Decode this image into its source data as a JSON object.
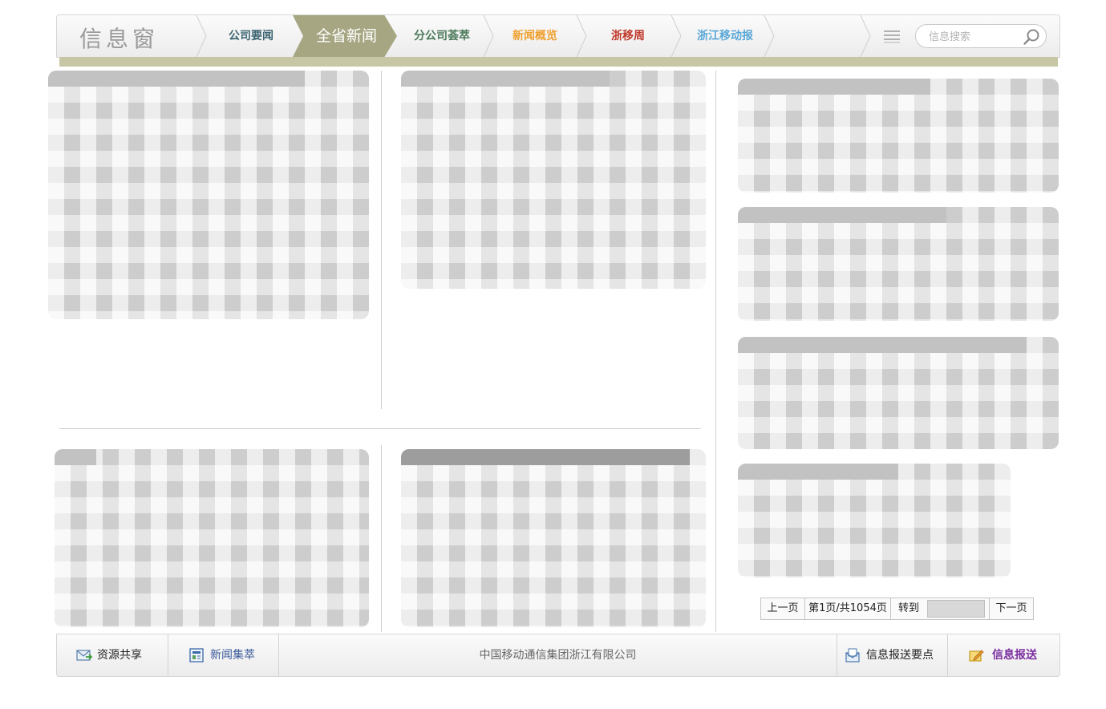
{
  "header": {
    "brand": "信息窗",
    "nav": [
      {
        "label": "公司要闻",
        "color": "#3c6472"
      },
      {
        "label": "全省新闻",
        "color": "#ffffff",
        "active": true
      },
      {
        "label": "分公司荟萃",
        "color": "#4d7a5b"
      },
      {
        "label": "新闻概览",
        "color": "#f0a030"
      },
      {
        "label": "浙移周",
        "color": "#c0392b"
      },
      {
        "label": "浙江移动报",
        "color": "#5aa8d8"
      }
    ],
    "search_placeholder": "信息搜索"
  },
  "pager": {
    "prev": "上一页",
    "info": "第1页/共1054页",
    "goto": "转到",
    "next": "下一页"
  },
  "footer": {
    "resource_share": "资源共享",
    "news_collection": "新闻集萃",
    "company": "中国移动通信集团浙江有限公司",
    "report_points": "信息报送要点",
    "report": "信息报送"
  },
  "colors": {
    "accent": "#a6a683",
    "bar": "#c7c7a6",
    "report_link": "#7b2fa0",
    "news_link": "#3a5a9a"
  }
}
